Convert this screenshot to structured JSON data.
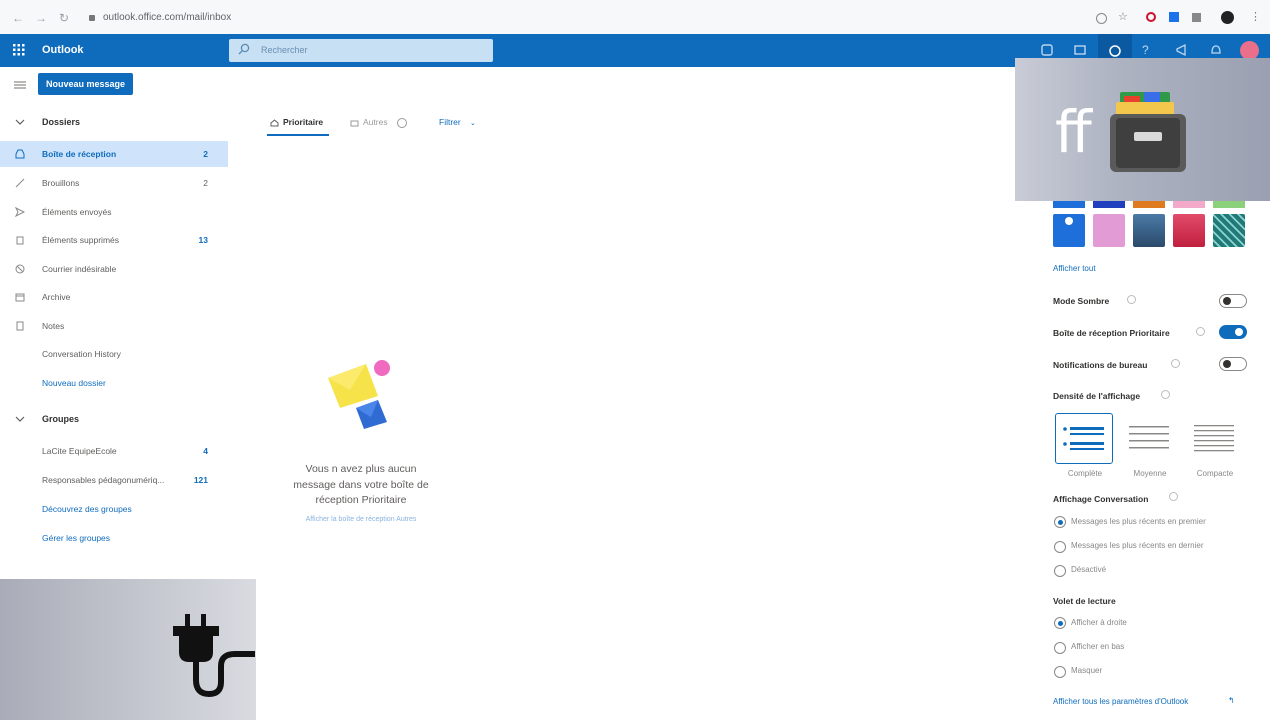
{
  "browser": {
    "url": "outlook.office.com/mail/inbox"
  },
  "header": {
    "app_name": "Outlook",
    "search_placeholder": "Rechercher"
  },
  "sidebar": {
    "new_message_label": "Nouveau message",
    "folders_heading": "Dossiers",
    "folders": [
      {
        "label": "Boîte de réception",
        "count": "2",
        "icon": "inbox-icon"
      },
      {
        "label": "Brouillons",
        "count": "2",
        "icon": "pencil-icon"
      },
      {
        "label": "Éléments envoyés",
        "count": "",
        "icon": "send-icon"
      },
      {
        "label": "Éléments supprimés",
        "count": "13",
        "icon": "trash-icon"
      },
      {
        "label": "Courrier indésirable",
        "count": "",
        "icon": "junk-icon"
      },
      {
        "label": "Archive",
        "count": "",
        "icon": "archive-icon"
      },
      {
        "label": "Notes",
        "count": "",
        "icon": "notes-icon"
      },
      {
        "label": "Conversation History",
        "count": "",
        "icon": ""
      }
    ],
    "new_folder_label": "Nouveau dossier",
    "groups_heading": "Groupes",
    "groups": [
      {
        "label": "LaCite EquipeEcole",
        "count": "4"
      },
      {
        "label": "Responsables pédagonumériq...",
        "count": "121"
      }
    ],
    "discover_groups_label": "Découvrez des groupes",
    "manage_groups_label": "Gérer les groupes"
  },
  "message_list": {
    "tab_focused": "Prioritaire",
    "tab_other": "Autres",
    "filter_label": "Filtrer",
    "empty_message": "Vous n avez plus aucun message dans votre boîte de réception Prioritaire",
    "empty_link": "Afficher la boîte de réception Autres"
  },
  "settings": {
    "show_all_themes": "Afficher tout",
    "dark_mode_label": "Mode Sombre",
    "dark_mode_on": false,
    "focused_inbox_label": "Boîte de réception Prioritaire",
    "focused_inbox_on": true,
    "desktop_notifications_label": "Notifications de bureau",
    "desktop_notifications_on": false,
    "density_heading": "Densité de l'affichage",
    "density_options": [
      "Complète",
      "Moyenne",
      "Compacte"
    ],
    "density_selected": "Complète",
    "conversation_heading": "Affichage Conversation",
    "conversation_options": [
      "Messages les plus récents en premier",
      "Messages les plus récents en dernier",
      "Désactivé"
    ],
    "conversation_selected": 0,
    "reading_pane_heading": "Volet de lecture",
    "reading_pane_options": [
      "Afficher à droite",
      "Afficher en bas",
      "Masquer"
    ],
    "reading_pane_selected": 0,
    "all_settings_link": "Afficher tous les paramètres d'Outlook",
    "theme_colors": [
      "#1e6fd9",
      "#e39bd6",
      "#2b4a6b",
      "#c0203e",
      "#1f7a78"
    ]
  },
  "overlays": {
    "ff_logo_text": "ff"
  },
  "colors": {
    "accent": "#0f6cbd",
    "selected_row": "#cfe4fa"
  }
}
